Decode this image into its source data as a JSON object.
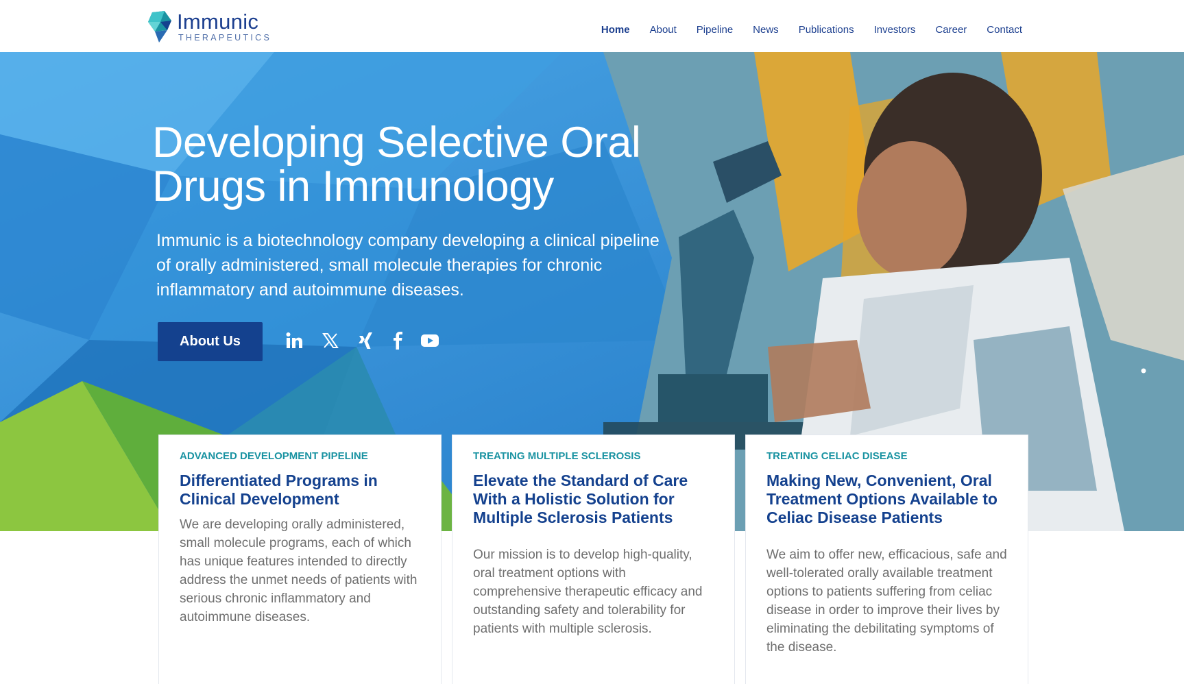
{
  "brand": {
    "name": "Immunic",
    "sub": "THERAPEUTICS",
    "colors": {
      "navy": "#14418e",
      "teal": "#1a93a2",
      "sky": "#3c93d3",
      "text_gray": "#6e6e6e"
    }
  },
  "nav": {
    "items": [
      {
        "label": "Home",
        "active": true
      },
      {
        "label": "About",
        "active": false
      },
      {
        "label": "Pipeline",
        "active": false
      },
      {
        "label": "News",
        "active": false
      },
      {
        "label": "Publications",
        "active": false
      },
      {
        "label": "Investors",
        "active": false
      },
      {
        "label": "Career",
        "active": false
      },
      {
        "label": "Contact",
        "active": false
      }
    ]
  },
  "hero": {
    "title_line1": "Developing Selective Oral",
    "title_line2": "Drugs in Immunology",
    "description": "Immunic is a biotechnology company developing a clinical pipeline of orally administered, small molecule therapies for chronic inflammatory and autoimmune diseases.",
    "cta_label": "About Us",
    "social_icons": [
      "linkedin-icon",
      "x-icon",
      "xing-icon",
      "facebook-icon",
      "youtube-icon"
    ]
  },
  "cards": [
    {
      "kicker": "ADVANCED DEVELOPMENT PIPELINE",
      "title": "Differentiated Programs in Clinical Development",
      "body": "We are developing orally administered, small molecule programs, each of which has unique features intended to directly address the unmet needs of patients with serious chronic inflammatory and autoimmune diseases."
    },
    {
      "kicker": "TREATING MULTIPLE SCLEROSIS",
      "title": "Elevate the Standard of Care With a Holistic Solution for Multiple Sclerosis Patients",
      "body": "Our mission is to develop high-quality, oral treatment options with comprehensive therapeutic efficacy and outstanding safety and tolerability for patients with multiple sclerosis."
    },
    {
      "kicker": "TREATING CELIAC DISEASE",
      "title": "Making New, Convenient, Oral Treatment Options Available to Celiac Disease Patients",
      "body": "We aim to offer new, efficacious, safe and well-tolerated orally available treatment options to patients suffering from celiac disease in order to improve their lives by eliminating the debilitating symptoms of the disease."
    }
  ]
}
